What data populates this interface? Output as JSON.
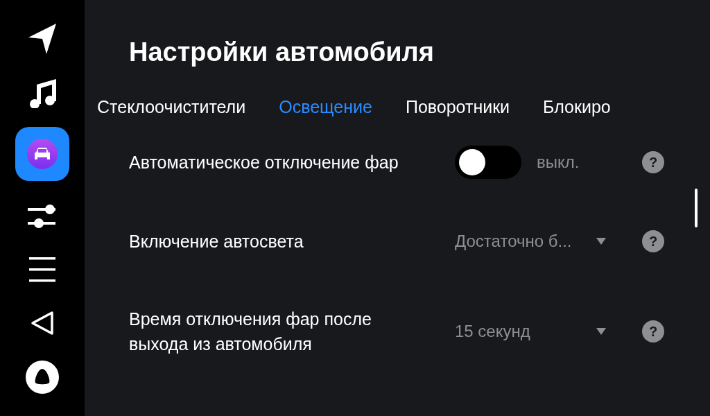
{
  "sidebar": {
    "items": [
      {
        "kind": "navigation",
        "selected": false
      },
      {
        "kind": "music",
        "selected": false
      },
      {
        "kind": "car",
        "selected": true
      },
      {
        "kind": "sliders",
        "selected": false
      },
      {
        "kind": "menu",
        "selected": false
      },
      {
        "kind": "back",
        "selected": false
      },
      {
        "kind": "assistant",
        "selected": false
      }
    ]
  },
  "title": "Настройки автомобиля",
  "tabs": [
    {
      "label": "Стеклоочистители",
      "selected": false
    },
    {
      "label": "Освещение",
      "selected": true
    },
    {
      "label": "Поворотники",
      "selected": false
    },
    {
      "label": "Блокиро",
      "selected": false
    }
  ],
  "settings": [
    {
      "kind": "toggle",
      "label": "Автоматическое отключение фар",
      "on": false,
      "state_text": "выкл.",
      "help": "?"
    },
    {
      "kind": "dropdown",
      "label": "Включение автосвета",
      "value": "Достаточно б...",
      "help": "?"
    },
    {
      "kind": "dropdown",
      "label": "Время отключения фар после выхода из автомобиля",
      "value": "15 секунд",
      "help": "?"
    }
  ]
}
